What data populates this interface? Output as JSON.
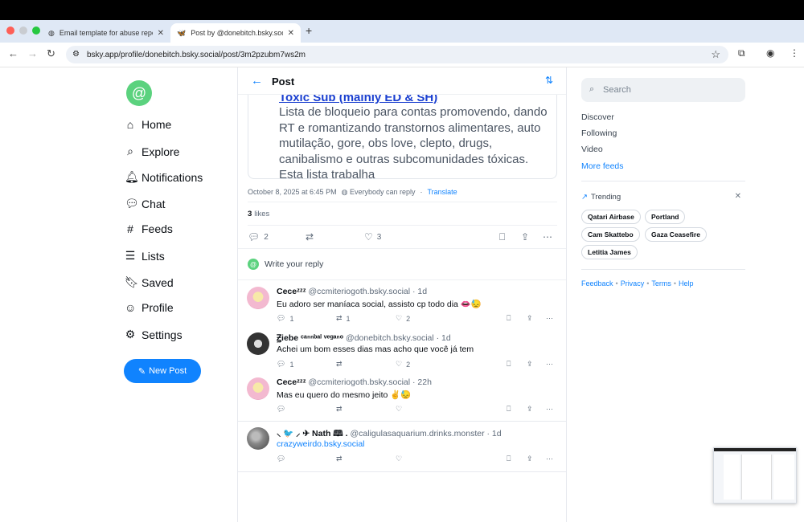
{
  "browser": {
    "tabs": [
      {
        "title": "Email template for abuse repo",
        "icon": "globe-icon"
      },
      {
        "title": "Post by @donebitch.bsky.social",
        "icon": "butterfly-icon"
      }
    ],
    "url": "bsky.app/profile/donebitch.bsky.social/post/3m2pzubm7ws2m"
  },
  "nav": {
    "logo_glyph": "@",
    "items": [
      {
        "label": "Home",
        "icon": "home-icon"
      },
      {
        "label": "Explore",
        "icon": "search-icon"
      },
      {
        "label": "Notifications",
        "icon": "bell-icon"
      },
      {
        "label": "Chat",
        "icon": "chat-icon"
      },
      {
        "label": "Feeds",
        "icon": "hash-icon"
      },
      {
        "label": "Lists",
        "icon": "list-icon"
      },
      {
        "label": "Saved",
        "icon": "bookmark-icon"
      },
      {
        "label": "Profile",
        "icon": "user-icon"
      },
      {
        "label": "Settings",
        "icon": "gear-icon"
      }
    ],
    "new_post": "New Post"
  },
  "post": {
    "header": "Post",
    "embed_title": "Toxic Sub (mainly ED & SH)",
    "embed_body": "Lista de bloqueio para contas promovendo, dando RT e romantizando transtornos alimentares, auto mutilação, gore, obs love, clepto, drugs, canibalismo e outras subcomunidades tóxicas. Esta lista trabalha",
    "date": "October 8, 2025 at 6:45 PM",
    "reply_setting": "Everybody can reply",
    "translate": "Translate",
    "likes_count": "3",
    "likes_label": "likes",
    "reply_count": "2",
    "like_count": "3",
    "reply_placeholder": "Write your reply"
  },
  "replies": [
    {
      "name": "Ceceᶻᶻᶻ",
      "handle": "@ccmiteriogoth.bsky.social · 1d",
      "text": "Eu adoro ser maníaca social, assisto cp todo dia 👄😓",
      "replies": "1",
      "reposts": "1",
      "likes": "2"
    },
    {
      "name": "Ꙃiebe ᶜᵃⁿⁿᵇᵃˡ ᵛᵉᵍᵃⁿᵒ",
      "handle": "@donebitch.bsky.social · 1d",
      "text": "Achei um bom esses dias mas acho que você já tem",
      "replies": "1",
      "reposts": "",
      "likes": "2"
    },
    {
      "name": "Ceceᶻᶻᶻ",
      "handle": "@ccmiteriogoth.bsky.social · 22h",
      "text": "Mas eu quero do mesmo jeito ✌️😓",
      "replies": "",
      "reposts": "",
      "likes": ""
    },
    {
      "name": "⸜ 🐦 ⸝ ✈ Nath 🕮 .",
      "handle": "@caligulasaquarium.drinks.monster · 1d",
      "text": "crazyweirdo.bsky.social",
      "replies": "",
      "reposts": "",
      "likes": ""
    }
  ],
  "sidebar": {
    "search_placeholder": "Search",
    "feeds": [
      "Discover",
      "Following",
      "Video",
      "More feeds"
    ],
    "trending_title": "Trending",
    "trends": [
      "Qatari Airbase",
      "Portland",
      "Cam Skattebo",
      "Gaza Ceasefire",
      "Letitia James"
    ],
    "footer": [
      "Feedback",
      "Privacy",
      "Terms",
      "Help"
    ]
  },
  "colors": {
    "accent": "#1083fe",
    "logo": "#5bd27e"
  }
}
